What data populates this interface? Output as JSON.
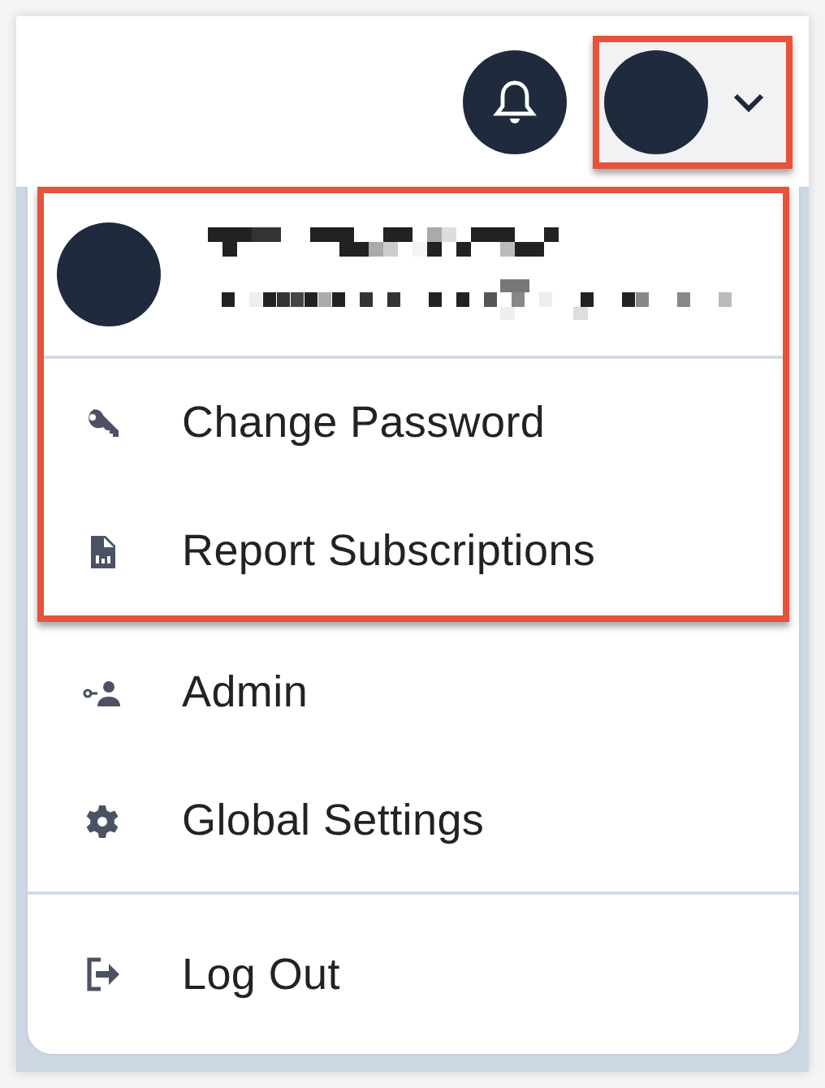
{
  "top_bar": {
    "notifications_button": {
      "kind": "bell"
    },
    "user_button": {
      "highlighted": true,
      "expanded": true
    }
  },
  "user_menu": {
    "profile": {
      "redacted": true,
      "highlighted": true
    },
    "items": [
      {
        "label": "Change Password",
        "kind": "key",
        "highlighted": true,
        "divider_before": true
      },
      {
        "label": "Report Subscriptions",
        "kind": "report",
        "highlighted": true,
        "divider_before": false
      },
      {
        "label": "Admin",
        "kind": "admin",
        "highlighted": false,
        "divider_before": false
      },
      {
        "label": "Global Settings",
        "kind": "gear",
        "highlighted": false,
        "divider_before": false
      },
      {
        "label": "Log Out",
        "kind": "logout",
        "highlighted": false,
        "divider_before": true
      }
    ]
  }
}
